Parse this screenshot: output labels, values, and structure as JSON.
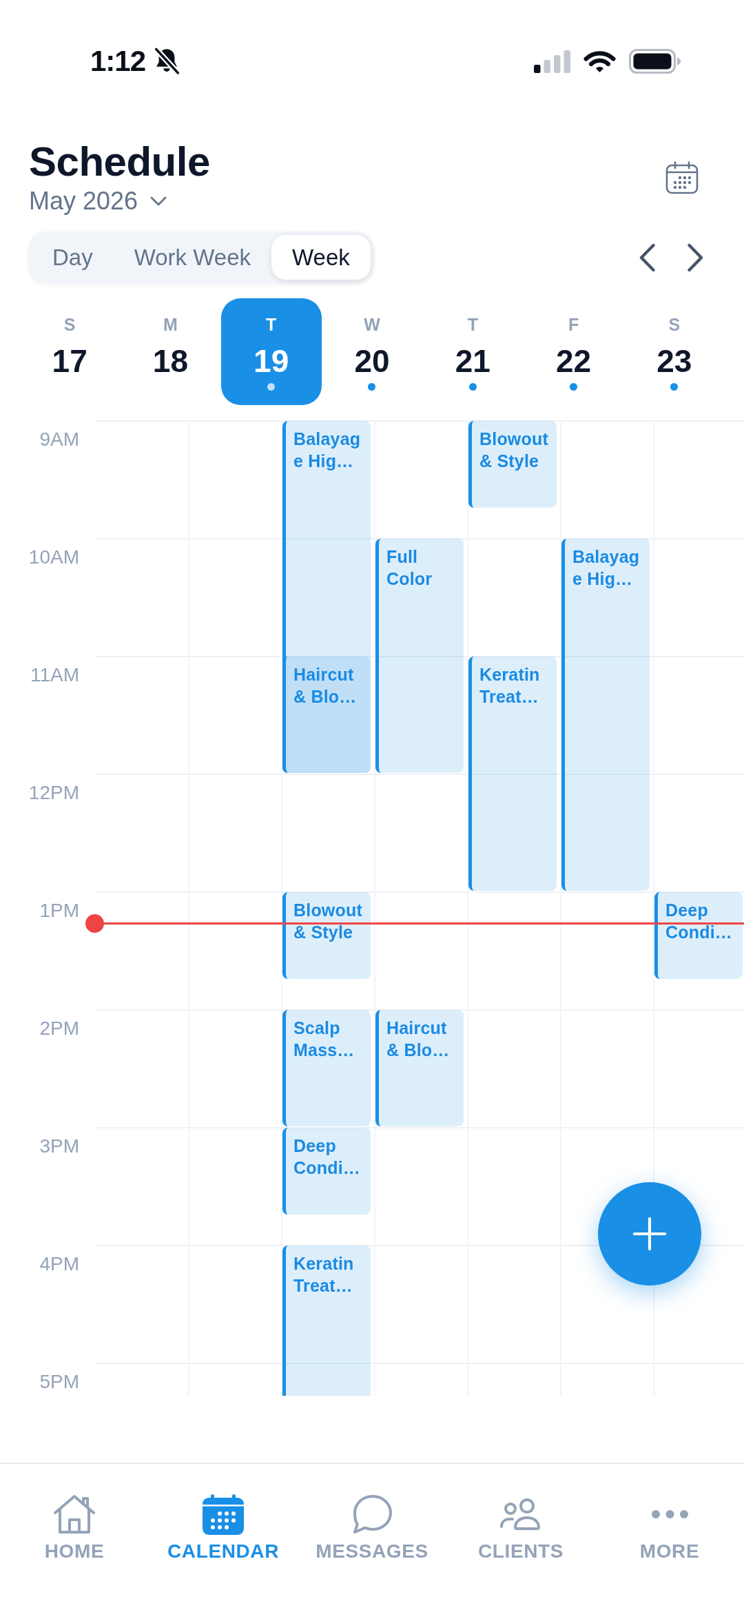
{
  "status_bar": {
    "time": "1:12",
    "silent": true
  },
  "header": {
    "title": "Schedule",
    "month": "May 2026"
  },
  "view_switch": [
    {
      "label": "Day",
      "selected": false
    },
    {
      "label": "Work Week",
      "selected": false
    },
    {
      "label": "Week",
      "selected": true
    }
  ],
  "week_strip": [
    {
      "weekday": "S",
      "date": "17",
      "selected": false,
      "has_events": false
    },
    {
      "weekday": "M",
      "date": "18",
      "selected": false,
      "has_events": false
    },
    {
      "weekday": "T",
      "date": "19",
      "selected": true,
      "has_events": true
    },
    {
      "weekday": "W",
      "date": "20",
      "selected": false,
      "has_events": true
    },
    {
      "weekday": "T",
      "date": "21",
      "selected": false,
      "has_events": true
    },
    {
      "weekday": "F",
      "date": "22",
      "selected": false,
      "has_events": true
    },
    {
      "weekday": "S",
      "date": "23",
      "selected": false,
      "has_events": true
    }
  ],
  "time_grid": {
    "rows": [
      {
        "label": "9AM",
        "current": false,
        "cells": [
          {},
          {},
          {
            "title": "Balayage Hig…",
            "kind": "triple"
          },
          {},
          {
            "title": "Blowout & Style",
            "kind": "short"
          },
          {},
          {}
        ]
      },
      {
        "label": "10AM",
        "current": false,
        "cells": [
          {},
          {},
          {},
          {
            "title": "Full Color",
            "kind": "double"
          },
          {},
          {
            "title": "Balayage Hig…",
            "kind": "triple"
          },
          {}
        ]
      },
      {
        "label": "11AM",
        "current": false,
        "cells": [
          {},
          {},
          {
            "title": "Haircut & Blo…",
            "kind": "single"
          },
          {},
          {
            "title": "Keratin Treat…",
            "kind": "double"
          },
          {},
          {}
        ]
      },
      {
        "label": "12PM",
        "current": false
      },
      {
        "label": "1PM",
        "current": true,
        "cells": [
          {},
          {},
          {
            "title": "Blowout & Style",
            "kind": "short"
          },
          {},
          {},
          {},
          {
            "title": "Deep Condi…",
            "kind": "short"
          }
        ]
      },
      {
        "label": "2PM",
        "current": false,
        "cells": [
          {},
          {},
          {
            "title": "Scalp Mass…",
            "kind": "single"
          },
          {
            "title": "Haircut & Blo…",
            "kind": "single"
          },
          {},
          {},
          {}
        ]
      },
      {
        "label": "3PM",
        "current": false,
        "cells": [
          {},
          {},
          {
            "title": "Deep Condi…",
            "kind": "short"
          },
          {},
          {},
          {},
          {}
        ]
      },
      {
        "label": "4PM",
        "current": false,
        "cells": [
          {},
          {},
          {
            "title": "Keratin Treat…",
            "kind": "double"
          },
          {},
          {},
          {},
          {}
        ]
      },
      {
        "label": "5PM",
        "current": false
      }
    ]
  },
  "tab_bar": [
    {
      "label": "HOME",
      "selected": false
    },
    {
      "label": "CALENDAR",
      "selected": true
    },
    {
      "label": "MESSAGES",
      "selected": false
    },
    {
      "label": "CLIENTS",
      "selected": false
    },
    {
      "label": "MORE",
      "selected": false
    }
  ]
}
